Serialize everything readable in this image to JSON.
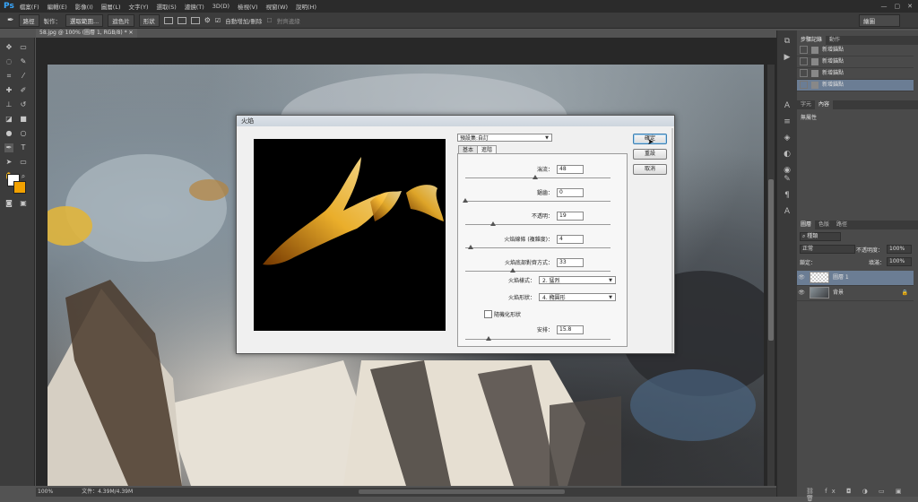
{
  "app": {
    "logo": "Ps",
    "menu": [
      "檔案(F)",
      "編輯(E)",
      "影像(I)",
      "圖層(L)",
      "文字(Y)",
      "選取(S)",
      "濾鏡(T)",
      "3D(D)",
      "檢視(V)",
      "視窗(W)",
      "說明(H)"
    ],
    "window_controls": [
      "—",
      "▢",
      "✕"
    ]
  },
  "options_bar": {
    "mode_label": "路徑",
    "make_label": "製作：",
    "selection_btn": "選取範圍...",
    "mask_btn": "遮色片",
    "shape_btn": "形狀",
    "auto_add_delete": "自動增加/刪除",
    "align_edges": "對齊邊緣",
    "workspace": "繪圖"
  },
  "document": {
    "tab_title": "58.jpg @ 100% (圖層 1, RGB/8) *",
    "zoom": "100%",
    "file_info": "文件：4.39M/4.39M"
  },
  "history_panel": {
    "tabs": [
      "步驟記錄",
      "動作"
    ],
    "items": [
      "新增錨點",
      "新增錨點",
      "新增錨點",
      "新增錨點"
    ]
  },
  "properties_panel": {
    "tabs": [
      "字元",
      "內容"
    ],
    "no_properties": "無屬性"
  },
  "layers_panel": {
    "tabs": [
      "圖層",
      "色版",
      "路徑"
    ],
    "kind_filter": "種類",
    "blend_mode": "正常",
    "opacity_label": "不透明度：",
    "opacity_value": "100%",
    "lock_label": "鎖定：",
    "fill_label": "填滿：",
    "fill_value": "100%",
    "layers": [
      {
        "name": "圖層 1",
        "selected": true
      },
      {
        "name": "背景",
        "selected": false
      }
    ]
  },
  "flame_dialog": {
    "title": "火焰",
    "preset": "預設集:自訂",
    "tabs": [
      "基本",
      "進階"
    ],
    "fields": [
      {
        "label": "湍流：",
        "value": "48",
        "slider": 0.48
      },
      {
        "label": "鋸齒：",
        "value": "0",
        "slider": 0.0
      },
      {
        "label": "不透明：",
        "value": "19",
        "slider": 0.19
      },
      {
        "label": "火焰線條 (複雜度)：",
        "value": "4",
        "slider": 0.04
      },
      {
        "label": "火焰底部對齊方式：",
        "value": "33",
        "slider": 0.33
      }
    ],
    "flame_style_label": "火焰樣式：",
    "flame_style_value": "2. 猛烈",
    "flame_shape_label": "火焰形狀：",
    "flame_shape_value": "4. 橢圓形",
    "randomize_label": "隨機化形狀",
    "arrangement_label": "安排：",
    "arrangement_value": "15.8",
    "arrangement_slider": 0.158,
    "buttons": {
      "ok": "確定",
      "reset": "重設",
      "cancel": "取消"
    }
  }
}
